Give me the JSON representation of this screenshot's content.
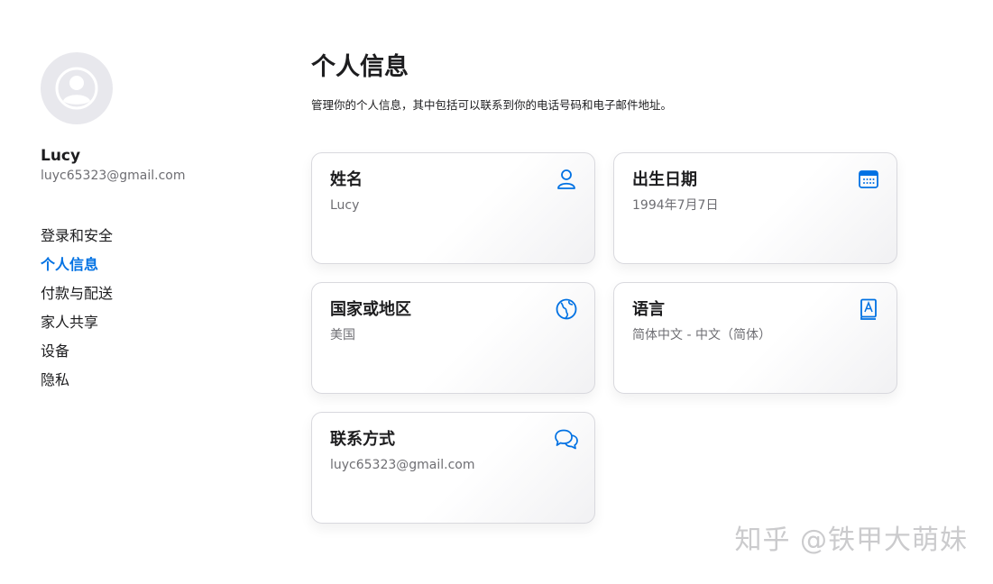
{
  "user": {
    "name": "Lucy",
    "email": "luyc65323@gmail.com",
    "avatar_icon": "person-circle-icon"
  },
  "nav": {
    "items": [
      {
        "label": "登录和安全",
        "active": false
      },
      {
        "label": "个人信息",
        "active": true
      },
      {
        "label": "付款与配送",
        "active": false
      },
      {
        "label": "家人共享",
        "active": false
      },
      {
        "label": "设备",
        "active": false
      },
      {
        "label": "隐私",
        "active": false
      }
    ]
  },
  "main": {
    "title": "个人信息",
    "description": "管理你的个人信息，其中包括可以联系到你的电话号码和电子邮件地址。"
  },
  "cards": [
    {
      "title": "姓名",
      "value": "Lucy",
      "icon": "person-icon"
    },
    {
      "title": "出生日期",
      "value": "1994年7月7日",
      "icon": "calendar-icon"
    },
    {
      "title": "国家或地区",
      "value": "美国",
      "icon": "globe-icon"
    },
    {
      "title": "语言",
      "value": "简体中文 - 中文（简体）",
      "icon": "dictionary-icon"
    },
    {
      "title": "联系方式",
      "value": "luyc65323@gmail.com",
      "icon": "chat-bubbles-icon"
    }
  ],
  "watermark": "知乎 @铁甲大萌妹",
  "colors": {
    "accent": "#0071e3",
    "text": "#1d1d1f",
    "secondary_text": "#6e6e73",
    "avatar_bg": "#e8e8ed",
    "card_border": "#d9d9de"
  }
}
